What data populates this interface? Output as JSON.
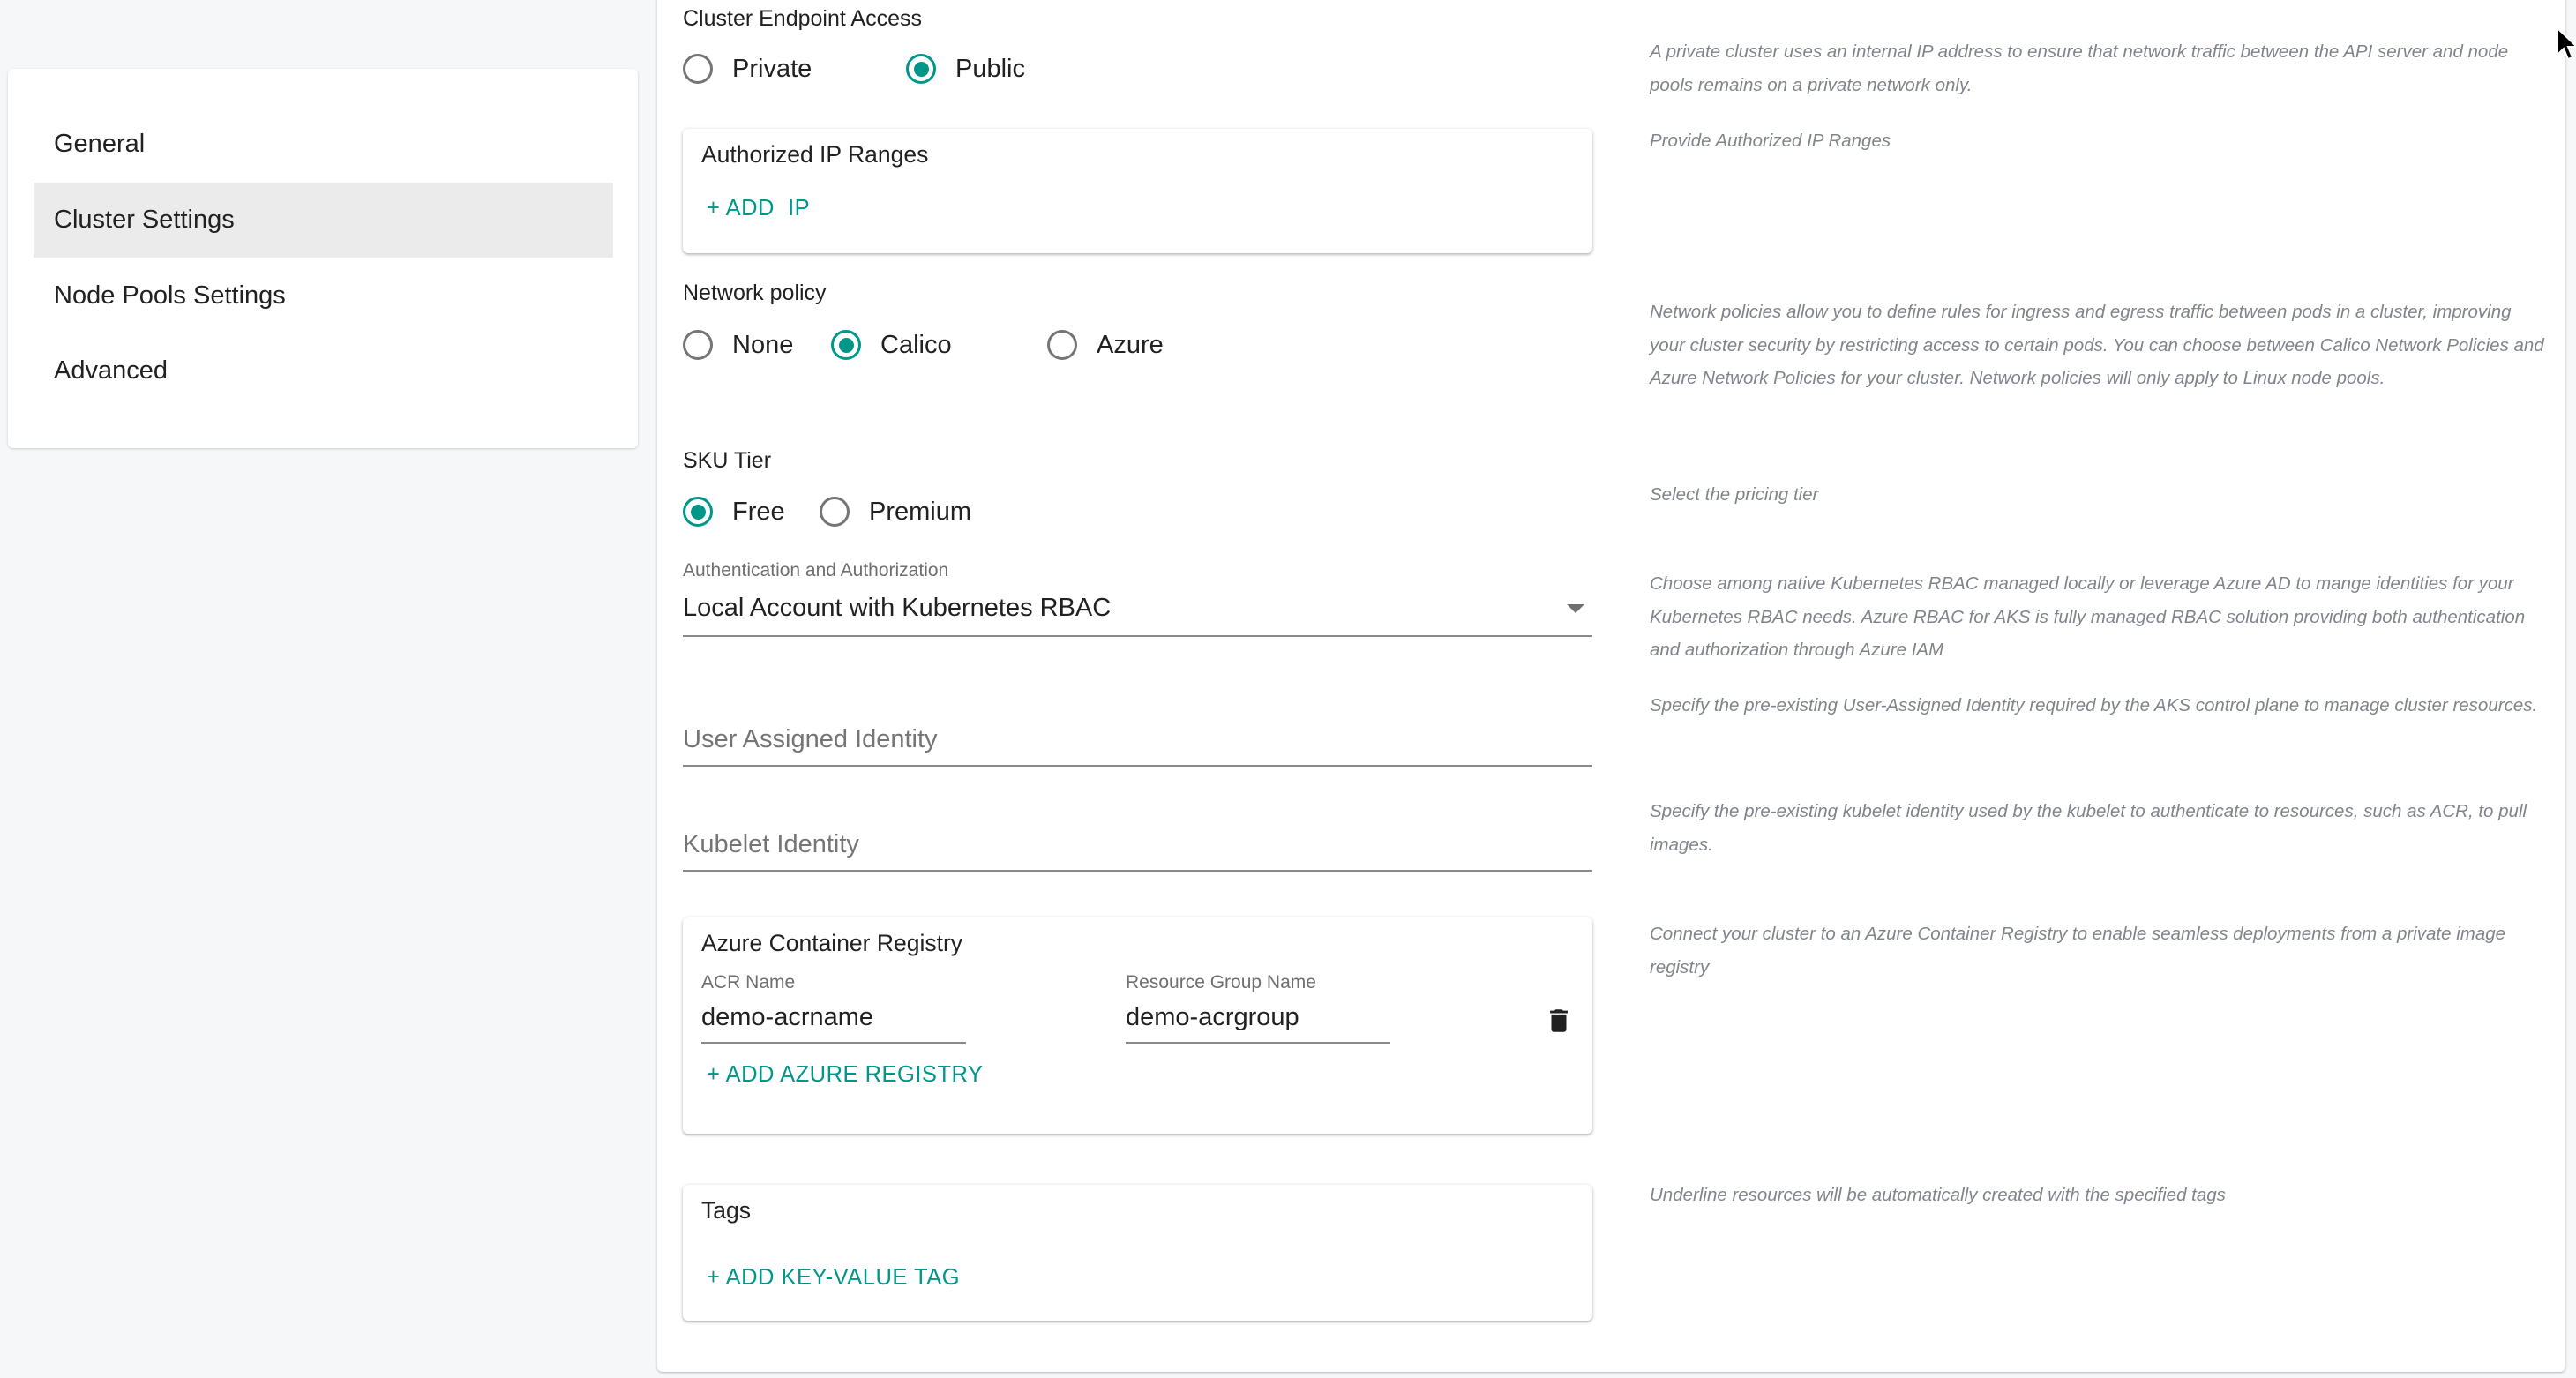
{
  "sidebar": {
    "items": [
      {
        "label": "General",
        "active": false
      },
      {
        "label": "Cluster Settings",
        "active": true
      },
      {
        "label": "Node Pools Settings",
        "active": false
      },
      {
        "label": "Advanced",
        "active": false
      }
    ]
  },
  "colors": {
    "accent": "#009688",
    "radio_unchecked": "#757575",
    "description_text": "#80858c",
    "active_nav_bg": "#ebebeb"
  },
  "form": {
    "endpoint_access": {
      "label": "Cluster Endpoint Access",
      "options": [
        "Private",
        "Public"
      ],
      "selected": "Public",
      "description": "A private cluster uses an internal IP address to ensure that network traffic between the API server and node pools remains on a private network only."
    },
    "authorized_ip": {
      "title": "Authorized IP Ranges",
      "add_button": "+ ADD  IP",
      "description": "Provide Authorized IP Ranges"
    },
    "network_policy": {
      "label": "Network policy",
      "options": [
        "None",
        "Calico",
        "Azure"
      ],
      "selected": "Calico",
      "description": "Network policies allow you to define rules for ingress and egress traffic between pods in a cluster, improving your cluster security by restricting access to certain pods. You can choose between Calico Network Policies and Azure Network Policies for your cluster. Network policies will only apply to Linux node pools."
    },
    "sku_tier": {
      "label": "SKU Tier",
      "options": [
        "Free",
        "Premium"
      ],
      "selected": "Free",
      "description": "Select the pricing tier"
    },
    "auth": {
      "label": "Authentication and Authorization",
      "value": "Local Account with Kubernetes RBAC",
      "description": "Choose among native Kubernetes RBAC managed locally or leverage Azure AD to mange identities for your Kubernetes RBAC needs. Azure RBAC for AKS is fully managed RBAC solution providing both authentication and authorization through Azure IAM"
    },
    "user_assigned_identity": {
      "placeholder": "User Assigned Identity",
      "value": "",
      "description": "Specify the pre-existing User-Assigned Identity required by the AKS control plane to manage cluster resources."
    },
    "kubelet_identity": {
      "placeholder": "Kubelet Identity",
      "value": "",
      "description": "Specify the pre-existing kubelet identity used by the kubelet to authenticate to resources, such as ACR, to pull images."
    },
    "acr": {
      "title": "Azure Container Registry",
      "entries": [
        {
          "acr_name_label": "ACR Name",
          "acr_name": "demo-acrname",
          "resource_group_label": "Resource Group Name",
          "resource_group": "demo-acrgroup",
          "delete_icon": "trash-icon"
        }
      ],
      "add_button": "+ ADD AZURE REGISTRY",
      "description": "Connect your cluster to an Azure Container Registry to enable seamless deployments from a private image registry"
    },
    "tags": {
      "title": "Tags",
      "add_button": "+ ADD KEY-VALUE TAG",
      "description": "Underline resources will be automatically created with the specified tags"
    }
  }
}
